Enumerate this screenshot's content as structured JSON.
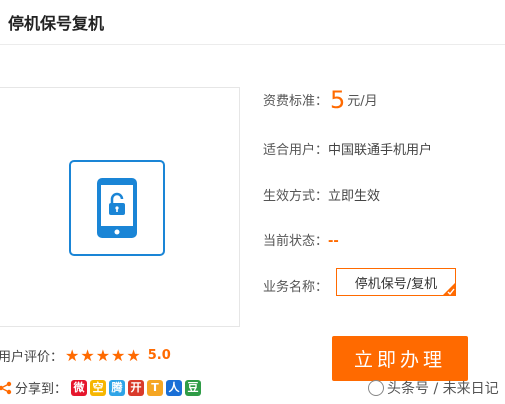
{
  "page": {
    "title": "停机保号复机"
  },
  "info": {
    "fee_label": "资费标准：",
    "fee_value": "5",
    "fee_unit": "元/月",
    "user_label": "适合用户：",
    "user_value": "中国联通手机用户",
    "effect_label": "生效方式：",
    "effect_value": "立即生效",
    "status_label": "当前状态：",
    "status_value": "--",
    "service_label": "业务名称：",
    "service_value": "停机保号/复机"
  },
  "rating": {
    "label": "用户评价：",
    "stars": 5,
    "score": "5.0"
  },
  "share": {
    "label": "分享到：",
    "icons": [
      {
        "name": "weibo-icon",
        "color": "#e6162d",
        "glyph": "微"
      },
      {
        "name": "qzone-icon",
        "color": "#f6b600",
        "glyph": "空"
      },
      {
        "name": "tqq-icon",
        "color": "#2fa4e7",
        "glyph": "腾"
      },
      {
        "name": "kaixin-icon",
        "color": "#d93a2b",
        "glyph": "开"
      },
      {
        "name": "tianya-icon",
        "color": "#f5a623",
        "glyph": "T"
      },
      {
        "name": "renren-icon",
        "color": "#1a6fd6",
        "glyph": "人"
      },
      {
        "name": "douban-icon",
        "color": "#2f9c47",
        "glyph": "豆"
      }
    ]
  },
  "cta": {
    "label": "立即办理"
  },
  "watermark": {
    "text": "头条号 / 未来日记"
  },
  "colors": {
    "accent": "#ff6a00",
    "icon_blue": "#1a85d6"
  }
}
